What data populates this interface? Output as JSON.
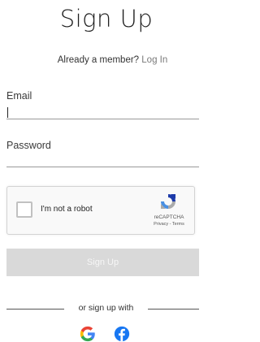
{
  "header": {
    "title": "Sign Up"
  },
  "member": {
    "prompt": "Already a member?",
    "login_label": "Log In"
  },
  "form": {
    "email_label": "Email",
    "email_value": "",
    "password_label": "Password",
    "password_value": ""
  },
  "recaptcha": {
    "checkbox_label": "I'm not a robot",
    "brand": "reCAPTCHA",
    "links": "Privacy - Terms"
  },
  "submit": {
    "label": "Sign Up"
  },
  "social": {
    "divider_text": "or sign up with",
    "providers": [
      "google-icon",
      "facebook-icon"
    ]
  },
  "colors": {
    "button_bg": "#d9d9d9",
    "link": "#7a7a7a",
    "google_blue": "#4285f4",
    "google_red": "#ea4335",
    "google_yellow": "#fbbc05",
    "google_green": "#34a853",
    "facebook_blue": "#1877f2"
  }
}
